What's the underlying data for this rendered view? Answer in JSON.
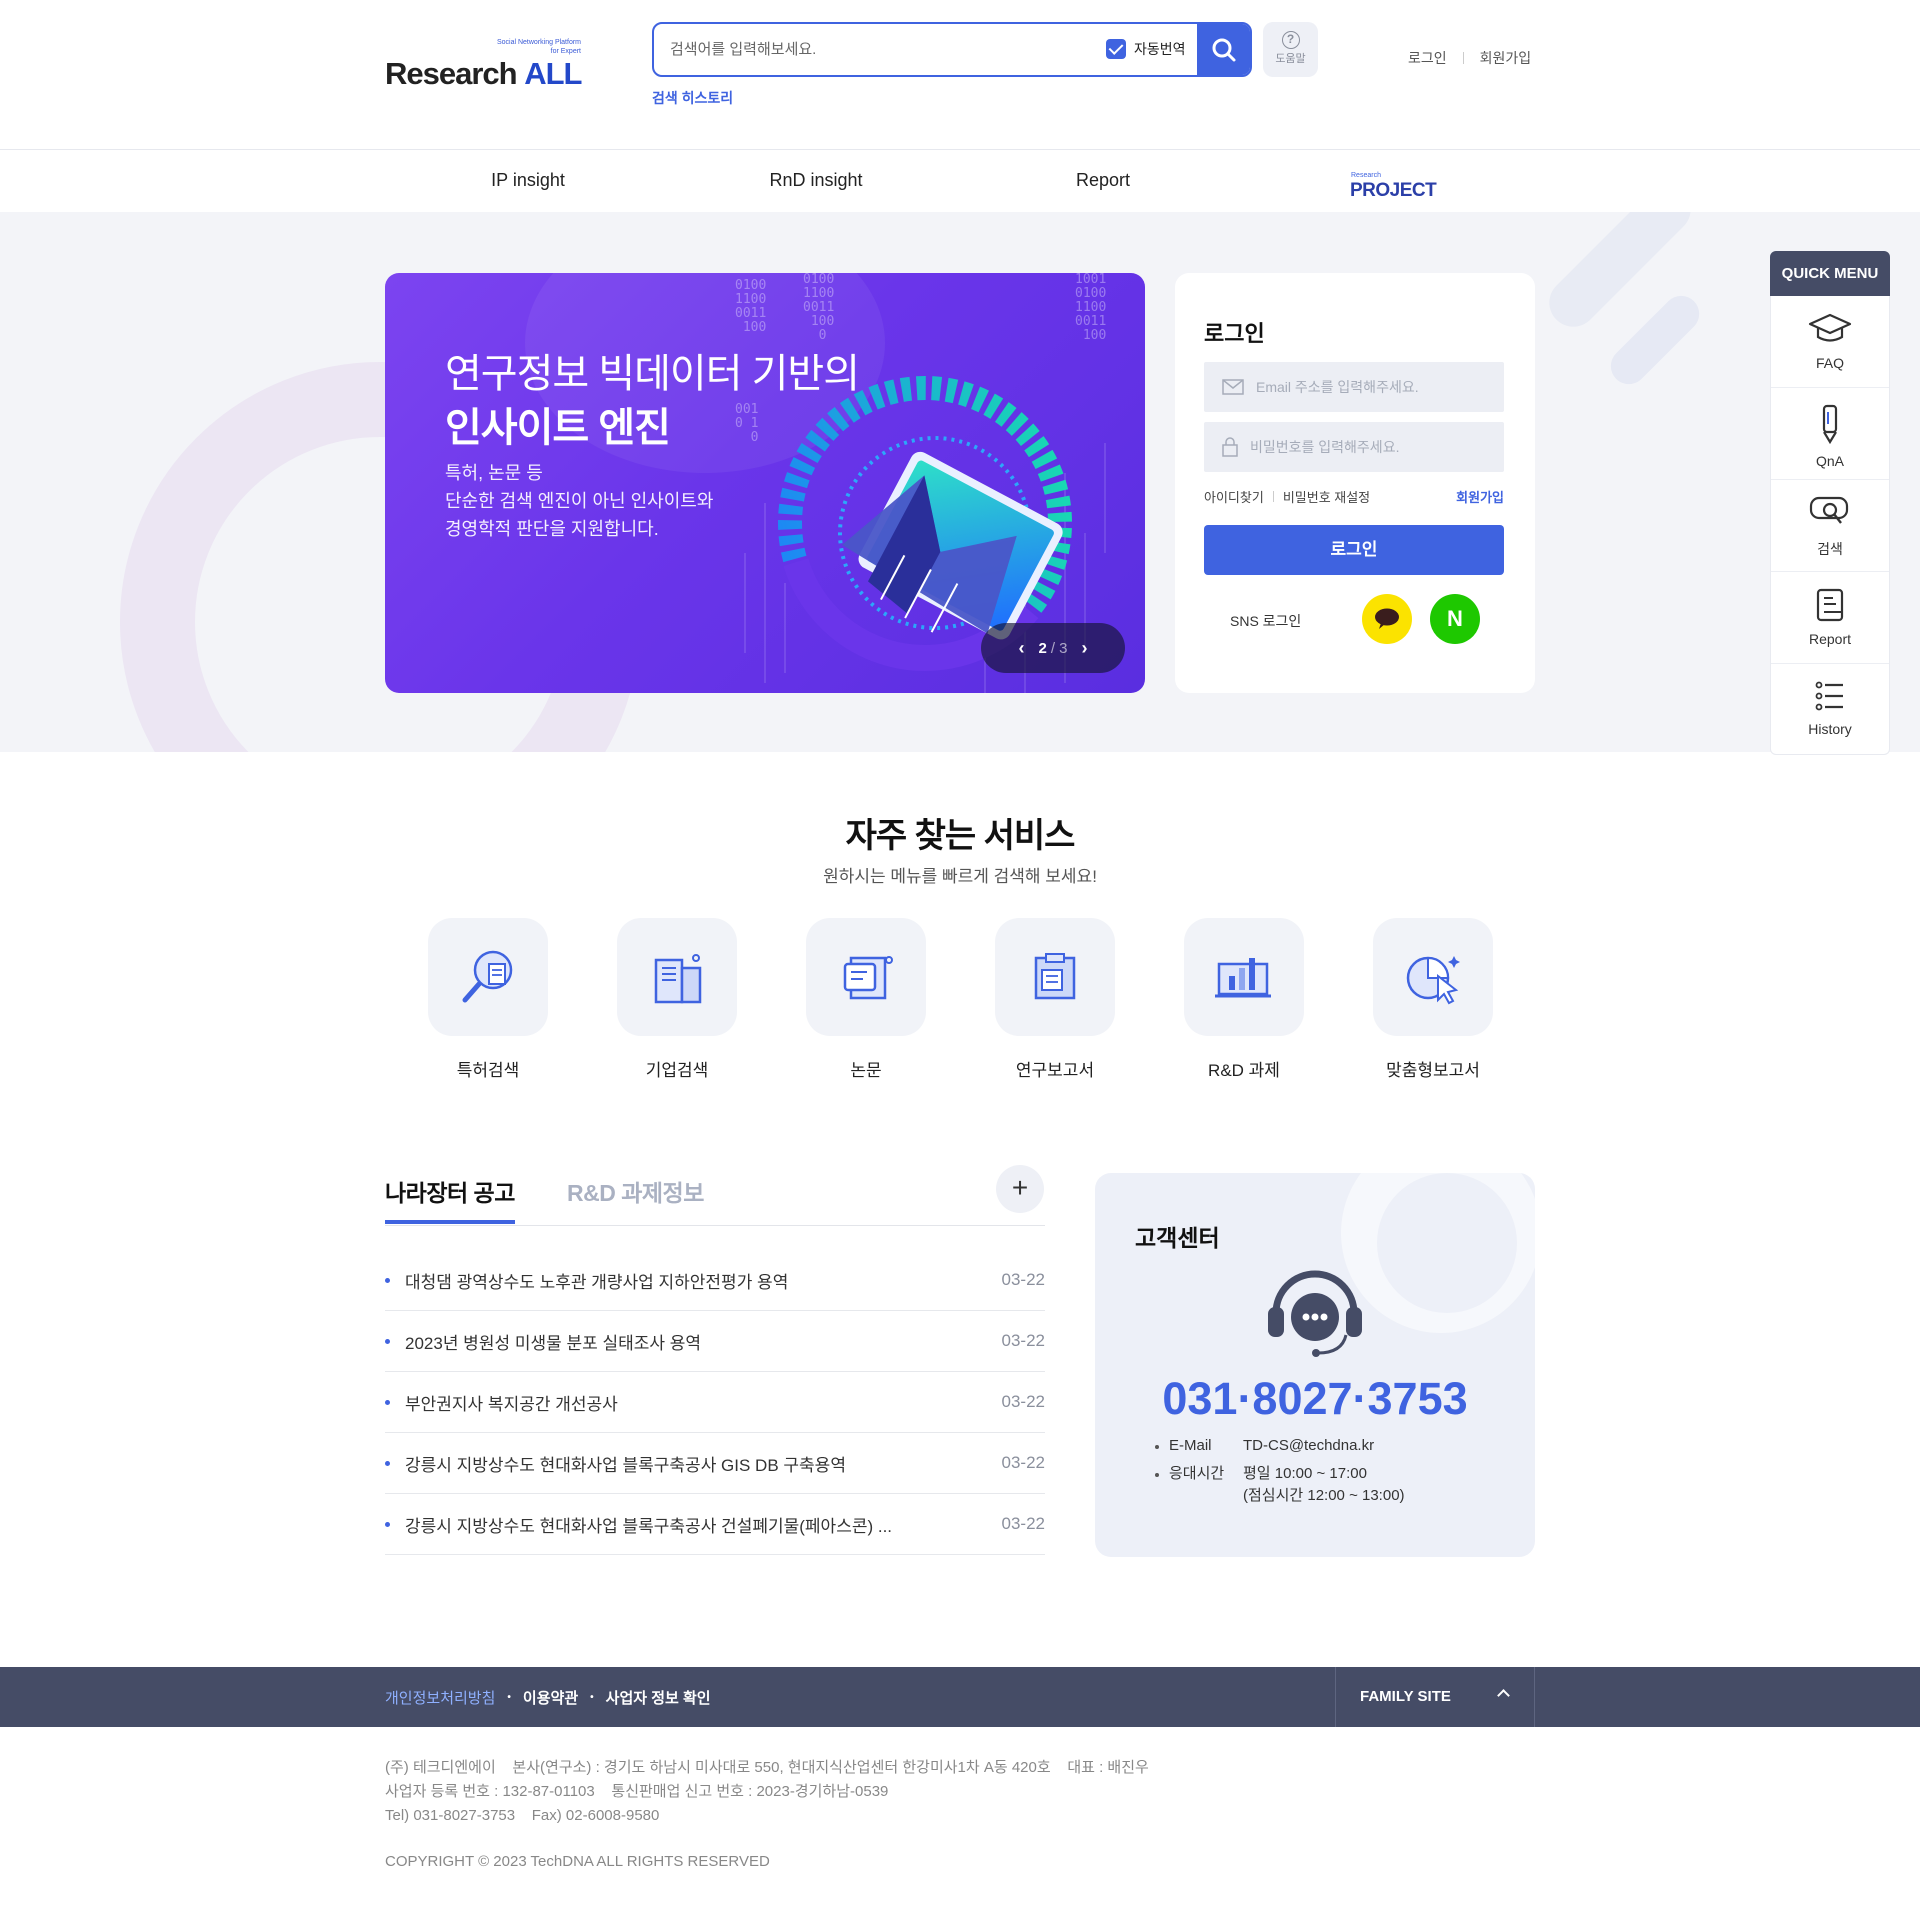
{
  "header": {
    "logo_tag_line1": "Social Networking Platform",
    "logo_tag_line2": "for Expert",
    "logo_word": "Research",
    "logo_word_bold": "ALL",
    "search_placeholder": "검색어를 입력해보세요.",
    "auto_translate_label": "자동번역",
    "auto_translate_checked": true,
    "help_label": "도움말",
    "search_history": "검색 히스토리",
    "login_link": "로그인",
    "signup_link": "회원가입"
  },
  "nav": {
    "items": [
      "IP insight",
      "RnD insight",
      "Report"
    ],
    "project_logo_small": "Research",
    "project_logo": "PROJECT"
  },
  "banner": {
    "title_line1": "연구정보 빅데이터 기반의",
    "title_line2": "인사이트 엔진",
    "desc_line1": "특허, 논문 등",
    "desc_line2": "단순한 검색 엔진이 아닌 인사이트와",
    "desc_line3": "경영학적 판단을 지원합니다.",
    "page_current": "2",
    "page_total": "/ 3",
    "prev_icon": "chevron-left-icon",
    "next_icon": "chevron-right-icon"
  },
  "login": {
    "title": "로그인",
    "email_placeholder": "Email 주소를 입력해주세요.",
    "password_placeholder": "비밀번호를 입력해주세요.",
    "find_id": "아이디찾기",
    "reset_password": "비밀번호 재설정",
    "join": "회원가입",
    "button": "로그인",
    "sns_label": "SNS 로그인",
    "naver_letter": "N"
  },
  "quick_menu": {
    "title": "QUICK MENU",
    "items": [
      {
        "label": "FAQ",
        "icon": "graduation-cap-icon"
      },
      {
        "label": "QnA",
        "icon": "pen-icon"
      },
      {
        "label": "검색",
        "icon": "search-chat-icon"
      },
      {
        "label": "Report",
        "icon": "report-icon"
      },
      {
        "label": "History",
        "icon": "list-icon"
      }
    ]
  },
  "services": {
    "title": "자주 찾는 서비스",
    "subtitle": "원하시는 메뉴를 빠르게 검색해 보세요!",
    "items": [
      {
        "label": "특허검색",
        "icon": "patent-search-icon"
      },
      {
        "label": "기업검색",
        "icon": "company-building-icon"
      },
      {
        "label": "논문",
        "icon": "paper-icon"
      },
      {
        "label": "연구보고서",
        "icon": "research-report-icon"
      },
      {
        "label": "R&D 과제",
        "icon": "rnd-chart-icon"
      },
      {
        "label": "맞춤형보고서",
        "icon": "custom-report-icon"
      }
    ]
  },
  "notices": {
    "tab_active": "나라장터 공고",
    "tab_inactive": "R&D 과제정보",
    "more_label": "+",
    "items": [
      {
        "title": "대청댐 광역상수도 노후관 개량사업 지하안전평가 용역",
        "date": "03-22"
      },
      {
        "title": "2023년 병원성 미생물 분포 실태조사 용역",
        "date": "03-22"
      },
      {
        "title": "부안권지사 복지공간 개선공사",
        "date": "03-22"
      },
      {
        "title": "강릉시 지방상수도 현대화사업 블록구축공사 GIS DB 구축용역",
        "date": "03-22"
      },
      {
        "title": "강릉시 지방상수도 현대화사업 블록구축공사 건설폐기물(페아스콘) ...",
        "date": "03-22"
      }
    ]
  },
  "customer_center": {
    "title": "고객센터",
    "phone": "031·8027·3753",
    "email_label": "E-Mail",
    "email": "TD-CS@techdna.kr",
    "hours_label": "응대시간",
    "hours": "평일 10:00 ~ 17:00",
    "lunch": "(점심시간 12:00 ~ 13:00)"
  },
  "footer": {
    "privacy": "개인정보처리방침",
    "terms": "이용약관",
    "business": "사업자 정보 확인",
    "bullet": "•",
    "family_site": "FAMILY SITE",
    "info_line1": "(주) 테크디엔에이    본사(연구소) : 경기도 하남시 미사대로 550, 현대지식산업센터 한강미사1차 A동 420호    대표 : 배진우",
    "info_line2": "사업자 등록 번호 : 132-87-01103    통신판매업 신고 번호 : 2023-경기하남-0539",
    "info_line3": "Tel) 031-8027-3753    Fax) 02-6008-9580",
    "copyright": "COPYRIGHT © 2023 TechDNA ALL RIGHTS RESERVED"
  },
  "colors": {
    "accent": "#3f63e0",
    "dark_bar": "#454c66",
    "banner_purple": "#6a35ea",
    "kakao": "#fbe300",
    "naver": "#1ec800"
  }
}
